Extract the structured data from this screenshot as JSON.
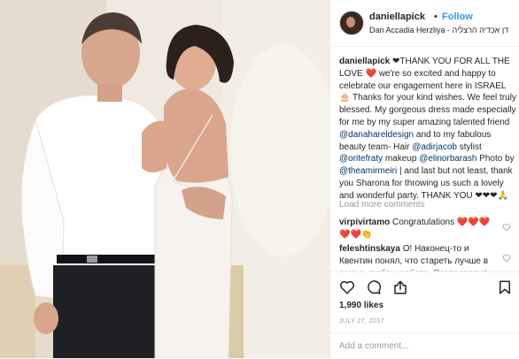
{
  "post": {
    "username": "daniellapick",
    "separator": "•",
    "follow_label": "Follow",
    "location": "Dan Accadia Herzliya - דן אכדיה הרצליה"
  },
  "caption": {
    "username": "daniellapick",
    "p1": " ❤THANK YOU FOR ALL THE LOVE ",
    "p2": " we're so excited and happy to celebrate our engagement here in ISRAEL ",
    "p3": " Thanks for your kind wishes. We feel truly blessed. My gorgeous dress made especially for me by my super amazing talented friend ",
    "m1": "@danahareldesign",
    "p4": " and to my fabulous beauty team- Hair ",
    "m2": "@adirjacob",
    "p5": " stylist ",
    "m3": "@oritefraty",
    "p6": " makeup ",
    "m4": "@elinorbarash",
    "p7": " Photo by ",
    "m5": "@theamirmeiri",
    "p8": " | and last but not least, thank you Sharona for throwing us such a lovely and wonderful party. THANK YOU ",
    "tail": "❤❤❤🙏"
  },
  "load_more": "Load more comments",
  "comments": [
    {
      "username": "virpivirtamo",
      "text": " Congratulations ❤️❤️❤️❤️❤️👏"
    },
    {
      "username": "feleshtinskaya",
      "text": " О! Наконец-то и Квентин понял, что стареть лучше в семье, любви, заботе. Поздравляю!"
    }
  ],
  "likes": "1,990 likes",
  "date": "JULY 27, 2017",
  "add_comment_placeholder": "Add a comment...",
  "icons": [
    "heart-icon",
    "comment-icon",
    "share-icon",
    "bookmark-icon"
  ],
  "colors": {
    "link": "#003569",
    "follow": "#3897f0",
    "heart": "#ed4956",
    "muted": "#999999"
  }
}
